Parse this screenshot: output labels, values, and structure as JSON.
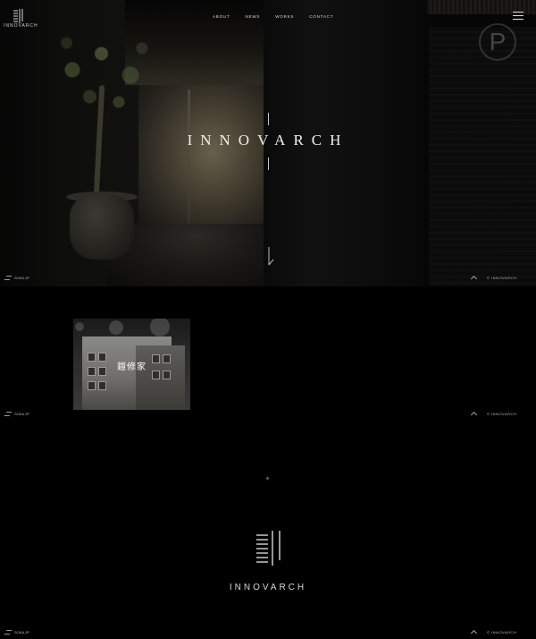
{
  "header": {
    "brand": "INNOVARCH",
    "nav": [
      "ABOUT",
      "NEWS",
      "WORKS",
      "CONTACT"
    ]
  },
  "hero": {
    "title": "INNOVARCH",
    "parking_sign": "P"
  },
  "section_bar": {
    "left_text": "SOKA.JP",
    "right_text": "© INNOVARCH"
  },
  "works": {
    "items": [
      {
        "label": "鎧修家"
      }
    ]
  },
  "footer_brand": {
    "name": "INNOVARCH"
  },
  "colors": {
    "background": "#000000",
    "text": "#e8e8e8",
    "accent": "#ffffff"
  }
}
